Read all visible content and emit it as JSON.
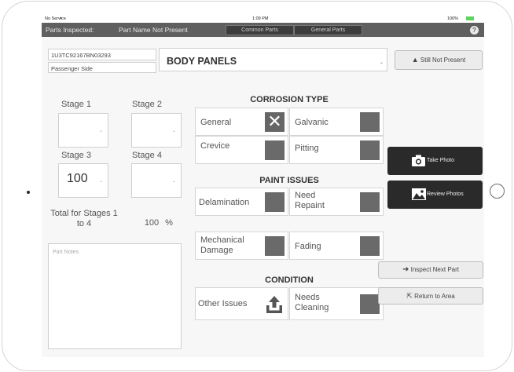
{
  "status": {
    "carrier": "No Service",
    "time": "1:09 PM",
    "battery": "100%"
  },
  "nav": {
    "title": "Parts Inspected:",
    "part": "Part Name Not Present",
    "tab_common": "Common Parts",
    "tab_general": "General Parts",
    "help": "?"
  },
  "vin": "1U3TC92167BN03293",
  "side": "Passenger Side",
  "section_title": "BODY PANELS",
  "still_not_present": "Still Not Present",
  "stages": [
    {
      "label": "Stage 1",
      "value": ""
    },
    {
      "label": "Stage 2",
      "value": ""
    },
    {
      "label": "Stage 3",
      "value": "100"
    },
    {
      "label": "Stage 4",
      "value": ""
    }
  ],
  "total": {
    "label": "Total for Stages 1 to 4",
    "value": "100",
    "unit": "%"
  },
  "notes_placeholder": "Part Notes",
  "corrosion": {
    "header": "CORROSION TYPE",
    "general": "General",
    "general_checked": true,
    "galvanic": "Galvanic",
    "crevice": "Crevice",
    "pitting": "Pitting"
  },
  "paint": {
    "header": "PAINT ISSUES",
    "delamination": "Delamination",
    "need_repaint": "Need Repaint",
    "mechanical_damage": "Mechanical Damage",
    "fading": "Fading"
  },
  "condition": {
    "header": "CONDITION",
    "other_issues": "Other Issues",
    "needs_cleaning": "Needs Cleaning"
  },
  "actions": {
    "take_photo": "Take Photo",
    "review_photos": "Review Photos",
    "inspect_next": "Inspect Next Part",
    "return_area": "Return to Area"
  }
}
